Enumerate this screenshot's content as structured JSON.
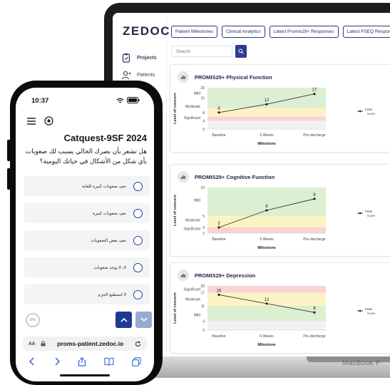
{
  "laptop": {
    "brand_label": "MacBook P",
    "app": {
      "logo": "ZEDOC",
      "sidebar": [
        {
          "label": "Projects",
          "icon": "clipboard-icon"
        },
        {
          "label": "Patients",
          "icon": "user-icon"
        }
      ],
      "nav_tabs": [
        "Patient Milestones",
        "Clinical Analytics",
        "Latest Promis29+ Responses",
        "Latest PSEQ Response"
      ],
      "search": {
        "placeholder": "Search",
        "icon": "search-icon"
      },
      "colors": {
        "accent": "#2b3d8f",
        "band_green": "#dcefd2",
        "band_yellow": "#fbf3c4",
        "band_red": "#f9d2d2",
        "line": "#333333"
      }
    }
  },
  "chart_data": [
    {
      "type": "line",
      "title": "PROMIS29+ Physical Function",
      "ylabel": "Level of concern",
      "xlabel": "Milestone",
      "categories": [
        "Baseline",
        "6 Weeks",
        "Pre-discharge"
      ],
      "series": [
        {
          "name": "Patie score",
          "values": [
            8,
            12,
            17
          ]
        }
      ],
      "ylim": [
        0,
        20
      ],
      "yticks": [
        0,
        4,
        8,
        15,
        20
      ],
      "band_labels": [
        {
          "label": "Mild",
          "y": 17.5
        },
        {
          "label": "Moderate",
          "y": 11
        },
        {
          "label": "Significant",
          "y": 5.5
        }
      ],
      "bands": [
        {
          "from": 0,
          "to": 4,
          "color": "#f2f2f2"
        },
        {
          "from": 4,
          "to": 6,
          "color": "#f9d2d2"
        },
        {
          "from": 6,
          "to": 10,
          "color": "#fbf3c4"
        },
        {
          "from": 10,
          "to": 20,
          "color": "#dcefd2"
        }
      ],
      "legend": "right"
    },
    {
      "type": "line",
      "title": "PROMIS29+ Cognitive Function",
      "ylabel": "Level of concern",
      "xlabel": "Milestone",
      "categories": [
        "Baseline",
        "6 Weeks",
        "Pre-discharge"
      ],
      "series": [
        {
          "name": "Patie score",
          "values": [
            3,
            6,
            8
          ]
        }
      ],
      "ylim": [
        2,
        10
      ],
      "yticks": [
        2,
        3,
        5,
        10
      ],
      "band_labels": [
        {
          "label": "Mild",
          "y": 7.8
        },
        {
          "label": "Moderate",
          "y": 4.3
        },
        {
          "label": "Significant",
          "y": 2.8
        }
      ],
      "bands": [
        {
          "from": 2,
          "to": 3,
          "color": "#f9d2d2"
        },
        {
          "from": 3,
          "to": 5,
          "color": "#fbf3c4"
        },
        {
          "from": 5,
          "to": 10,
          "color": "#dcefd2"
        }
      ],
      "legend": "right"
    },
    {
      "type": "line",
      "title": "PROMIS29+ Depression",
      "ylabel": "Level of concern",
      "xlabel": "Milestone",
      "categories": [
        "Baseline",
        "6 Weeks",
        "Pre-discharge"
      ],
      "series": [
        {
          "name": "Patie score",
          "values": [
            16,
            12,
            8
          ]
        }
      ],
      "ylim": [
        0,
        20
      ],
      "yticks": [
        0,
        4,
        11,
        17,
        20
      ],
      "band_labels": [
        {
          "label": "Significant",
          "y": 18.5
        },
        {
          "label": "Moderate",
          "y": 14
        },
        {
          "label": "Mild",
          "y": 7
        }
      ],
      "bands": [
        {
          "from": 0,
          "to": 4,
          "color": "#f2f2f2"
        },
        {
          "from": 4,
          "to": 11,
          "color": "#dcefd2"
        },
        {
          "from": 11,
          "to": 17,
          "color": "#fbf3c4"
        },
        {
          "from": 17,
          "to": 20,
          "color": "#f9d2d2"
        }
      ],
      "legend": "right"
    }
  ],
  "phone": {
    "time": "10:37",
    "survey_title": "Catquest-9SF 2024",
    "question": "هل تشعر بأن بصرك الحالي يسبب لك صعوبات بأي شكل من الأشكال في حياتك اليومية؟",
    "options": [
      "نعم، صعوبات كبيرة للغاية",
      "نعم، صعوبات كبيرة",
      "نعم، بعض الصعوبات",
      "لا، لا يوجد صعوبات",
      "لا استطيع الجزم"
    ],
    "progress": "0%",
    "url": "proms-patient.zedoc.io",
    "aa_label": "AA"
  }
}
